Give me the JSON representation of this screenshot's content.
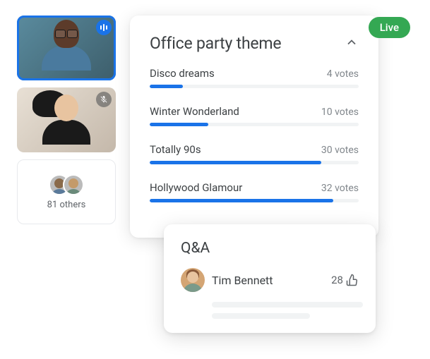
{
  "live_label": "Live",
  "participants": {
    "tile1_status": "speaking",
    "tile2_status": "muted",
    "others_count_label": "81 others"
  },
  "poll": {
    "title": "Office party theme",
    "options": [
      {
        "label": "Disco dreams",
        "votes_text": "4 votes",
        "percent": 16
      },
      {
        "label": "Winter Wonderland",
        "votes_text": "10 votes",
        "percent": 28
      },
      {
        "label": "Totally 90s",
        "votes_text": "30 votes",
        "percent": 82
      },
      {
        "label": "Hollywood Glamour",
        "votes_text": "32 votes",
        "percent": 88
      }
    ]
  },
  "qa": {
    "title": "Q&A",
    "item": {
      "name": "Tim Bennett",
      "upvotes": "28"
    }
  },
  "chart_data": {
    "type": "bar",
    "title": "Office party theme",
    "categories": [
      "Disco dreams",
      "Winter Wonderland",
      "Totally 90s",
      "Hollywood Glamour"
    ],
    "values": [
      4,
      10,
      30,
      32
    ],
    "xlabel": "",
    "ylabel": "votes",
    "ylim": [
      0,
      40
    ]
  },
  "colors": {
    "accent": "#1a73e8",
    "live": "#34a853",
    "text": "#3c4043",
    "muted_text": "#5f6368"
  },
  "icons": {
    "speaking": "speaking-icon",
    "muted": "mic-off-icon",
    "collapse": "chevron-up-icon",
    "thumbs_up": "thumbs-up-icon"
  }
}
